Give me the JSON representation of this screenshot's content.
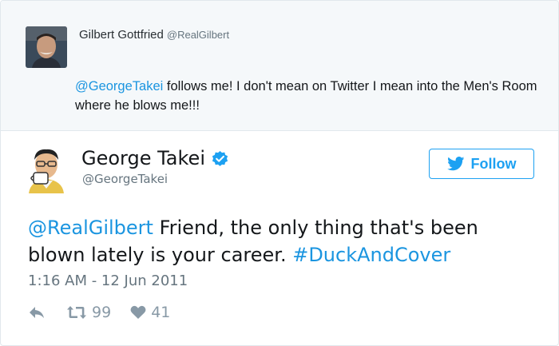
{
  "quoted_tweet": {
    "name": "Gilbert Gottfried",
    "handle": "@RealGilbert",
    "text_mention": "@GeorgeTakei",
    "text_body": " follows me! I don't mean on Twitter I mean into the Men's Room where he blows me!!!"
  },
  "tweet": {
    "name": "George Takei",
    "handle": "@GeorgeTakei",
    "verified": true,
    "follow_label": "Follow",
    "text_mention": "@RealGilbert",
    "text_body": " Friend, the only thing that's been blown lately is your career. ",
    "text_hashtag": "#DuckAndCover",
    "timestamp": "1:16 AM - 12 Jun 2011",
    "retweets": "99",
    "likes": "41"
  },
  "colors": {
    "link": "#1b95e0",
    "accent": "#1da1f2",
    "muted": "#8899a6"
  }
}
